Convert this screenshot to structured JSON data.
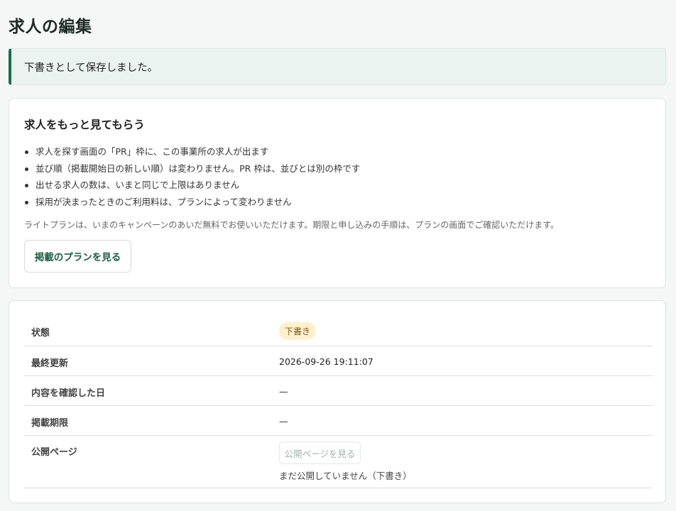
{
  "page": {
    "title": "求人の編集"
  },
  "flash": {
    "message": "下書きとして保存しました。"
  },
  "promo": {
    "title": "求人をもっと見てもらう",
    "bullets": [
      "求人を探す画面の「PR」枠に、この事業所の求人が出ます",
      "並び順（掲載開始日の新しい順）は変わりません。PR 枠は、並びとは別の枠です",
      "出せる求人の数は、いまと同じで上限はありません",
      "採用が決まったときのご利用料は、プランによって変わりません"
    ],
    "note": "ライトプランは、いまのキャンペーンのあいだ無料でお使いいただけます。期限と申し込みの手順は、プランの画面でご確認いただけます。",
    "button_label": "掲載のプランを見る"
  },
  "info": {
    "rows": {
      "status": {
        "label": "状態",
        "value": "下書き"
      },
      "updated": {
        "label": "最終更新",
        "value": "2026-09-26 19:11:07"
      },
      "checked": {
        "label": "内容を確認した日",
        "value": "—"
      },
      "period": {
        "label": "掲載期限",
        "value": "—"
      },
      "public": {
        "label": "公開ページ",
        "button_label": "公開ページを見る",
        "note": "まだ公開していません（下書き）"
      }
    }
  },
  "colors": {
    "accent": "#1f6a4d",
    "flash_bg": "#ebf3f0",
    "badge_bg": "#fdf0cf",
    "badge_text": "#7a5a10"
  }
}
